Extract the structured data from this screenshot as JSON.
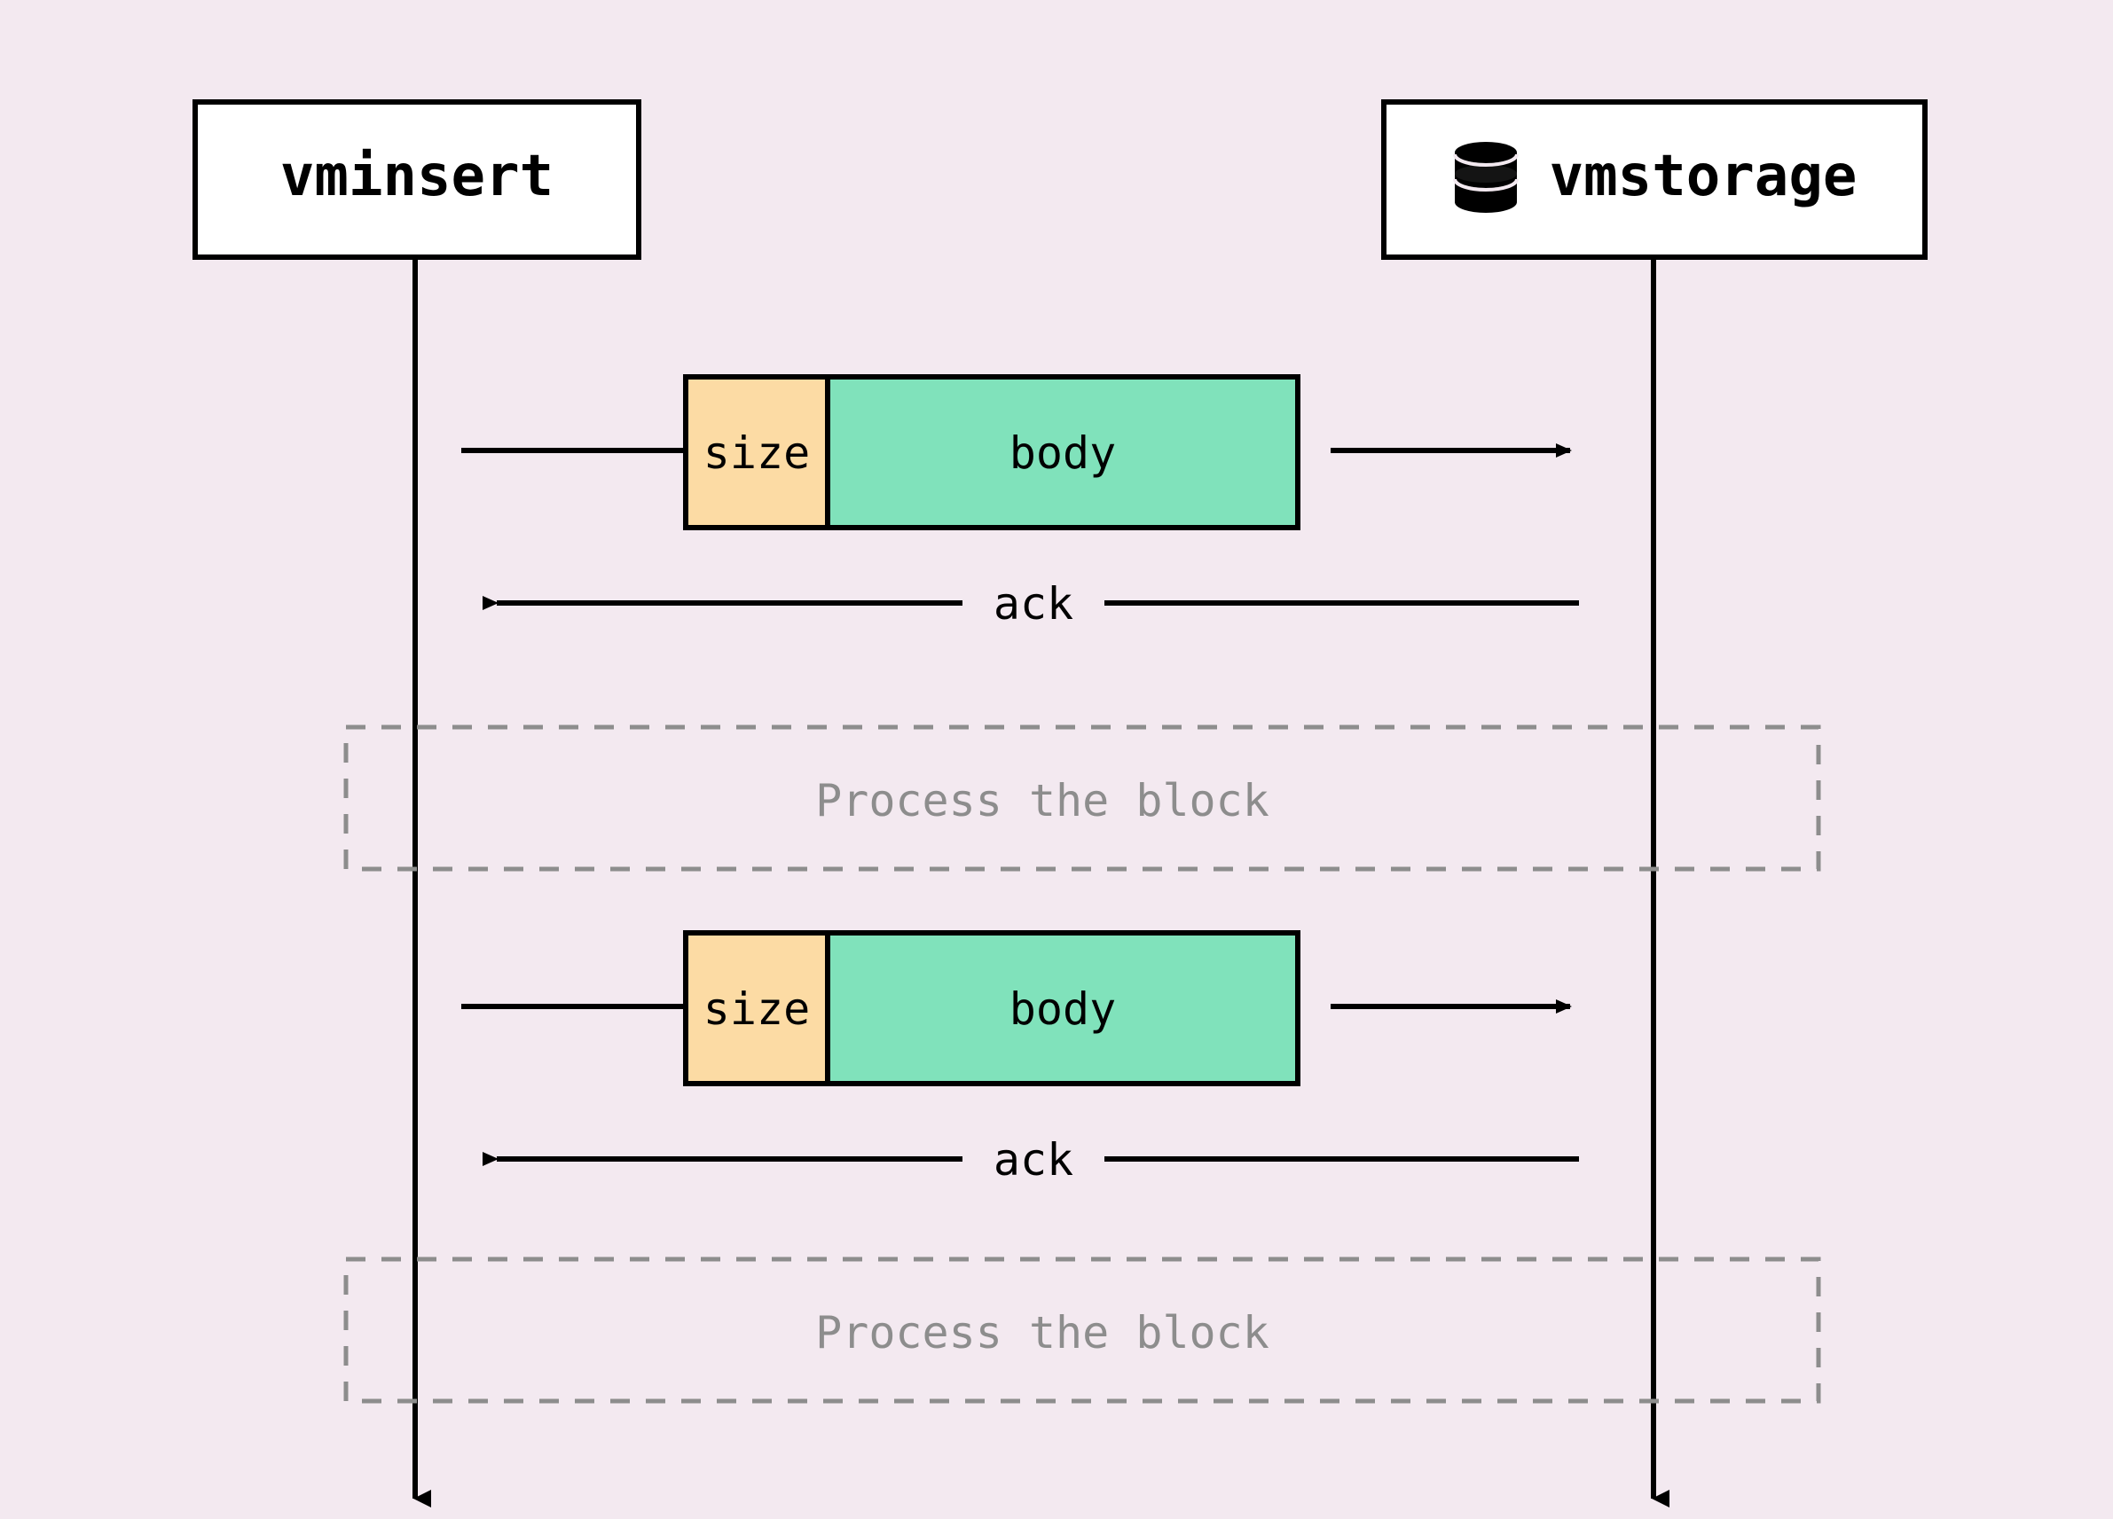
{
  "participants": {
    "left": {
      "label": "vminsert"
    },
    "right": {
      "label": "vmstorage"
    }
  },
  "packet": {
    "size_label": "size",
    "body_label": "body",
    "size_fill": "#fcdba4",
    "body_fill": "#80e2bb"
  },
  "messages": {
    "ack_label": "ack"
  },
  "process_box": {
    "label": "Process the block"
  },
  "colors": {
    "bg": "#f3e9f0",
    "stroke": "#000000",
    "dashed_stroke": "#8d8d8d",
    "dashed_text": "#8d8d8d",
    "white": "#ffffff"
  }
}
